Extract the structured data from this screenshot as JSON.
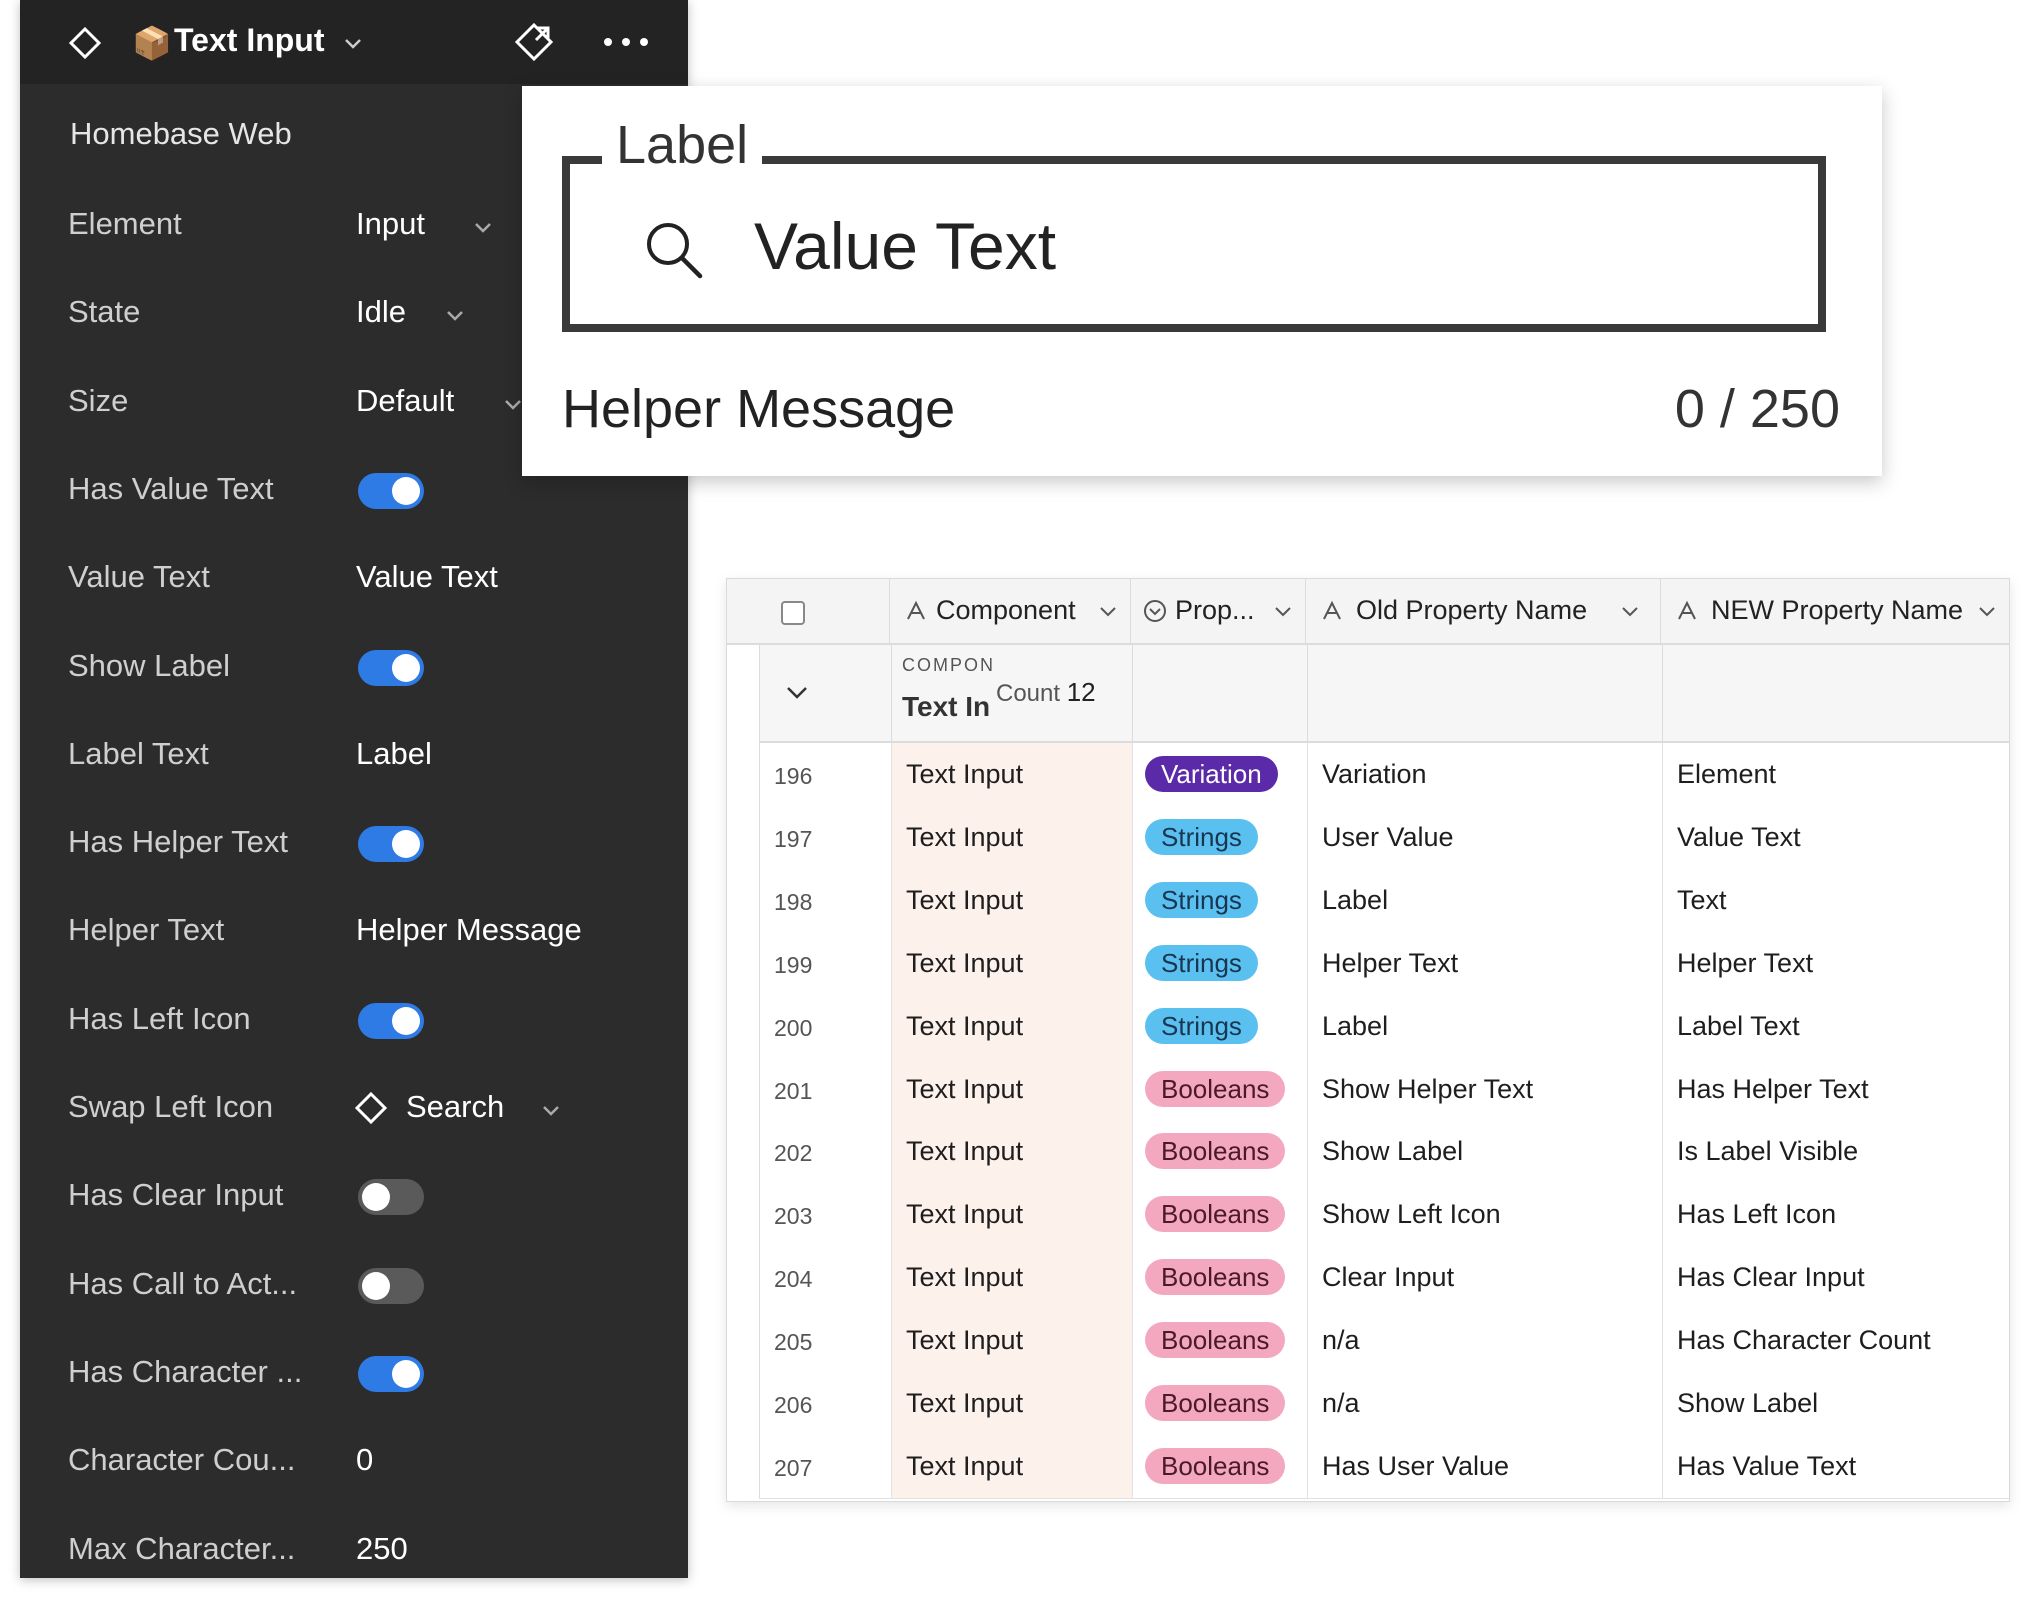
{
  "panel": {
    "title": "Text Input",
    "library": "Homebase Web",
    "properties": [
      {
        "label": "Element",
        "type": "dropdown",
        "value": "Input"
      },
      {
        "label": "State",
        "type": "dropdown",
        "value": "Idle"
      },
      {
        "label": "Size",
        "type": "dropdown",
        "value": "Default"
      },
      {
        "label": "Has Value Text",
        "type": "toggle",
        "on": true
      },
      {
        "label": "Value Text",
        "type": "text",
        "value": "Value Text"
      },
      {
        "label": "Show Label",
        "type": "toggle",
        "on": true
      },
      {
        "label": "Label Text",
        "type": "text",
        "value": "Label"
      },
      {
        "label": "Has Helper Text",
        "type": "toggle",
        "on": true
      },
      {
        "label": "Helper Text",
        "type": "text",
        "value": "Helper Message"
      },
      {
        "label": "Has Left Icon",
        "type": "toggle",
        "on": true
      },
      {
        "label": "Swap Left Icon",
        "type": "instance",
        "value": "Search"
      },
      {
        "label": "Has Clear Input",
        "type": "toggle",
        "on": false
      },
      {
        "label": "Has Call to Act...",
        "type": "toggle",
        "on": false
      },
      {
        "label": "Has Character ...",
        "type": "toggle",
        "on": true
      },
      {
        "label": "Character Cou...",
        "type": "text",
        "value": "0"
      },
      {
        "label": "Max Character...",
        "type": "text",
        "value": "250"
      }
    ],
    "toggle_on_color": "#2f7be6"
  },
  "preview": {
    "label": "Label",
    "value": "Value Text",
    "helper": "Helper Message",
    "counter": "0 / 250",
    "icon": "search-icon"
  },
  "table": {
    "columns": [
      {
        "label": "Component",
        "icon": "text-field-icon"
      },
      {
        "label": "Prop...",
        "icon": "single-select-icon"
      },
      {
        "label": "Old Property Name",
        "icon": "text-field-icon"
      },
      {
        "label": "NEW Property Name",
        "icon": "text-field-icon"
      }
    ],
    "group": {
      "field": "COMPON",
      "value": "Text In",
      "count_label": "Count",
      "count": "12"
    },
    "rows": [
      {
        "num": "196",
        "component": "Text Input",
        "prop": "Variation",
        "prop_kind": "variation",
        "old": "Variation",
        "new": "Element"
      },
      {
        "num": "197",
        "component": "Text Input",
        "prop": "Strings",
        "prop_kind": "strings",
        "old": "User Value",
        "new": "Value Text"
      },
      {
        "num": "198",
        "component": "Text Input",
        "prop": "Strings",
        "prop_kind": "strings",
        "old": "Label",
        "new": "Text"
      },
      {
        "num": "199",
        "component": "Text Input",
        "prop": "Strings",
        "prop_kind": "strings",
        "old": "Helper Text",
        "new": "Helper Text"
      },
      {
        "num": "200",
        "component": "Text Input",
        "prop": "Strings",
        "prop_kind": "strings",
        "old": "Label",
        "new": "Label Text"
      },
      {
        "num": "201",
        "component": "Text Input",
        "prop": "Booleans",
        "prop_kind": "booleans",
        "old": "Show Helper Text",
        "new": "Has Helper Text"
      },
      {
        "num": "202",
        "component": "Text Input",
        "prop": "Booleans",
        "prop_kind": "booleans",
        "old": "Show Label",
        "new": "Is Label Visible"
      },
      {
        "num": "203",
        "component": "Text Input",
        "prop": "Booleans",
        "prop_kind": "booleans",
        "old": "Show Left Icon",
        "new": "Has Left Icon"
      },
      {
        "num": "204",
        "component": "Text Input",
        "prop": "Booleans",
        "prop_kind": "booleans",
        "old": "Clear Input",
        "new": "Has Clear Input"
      },
      {
        "num": "205",
        "component": "Text Input",
        "prop": "Booleans",
        "prop_kind": "booleans",
        "old": "n/a",
        "new": "Has Character Count"
      },
      {
        "num": "206",
        "component": "Text Input",
        "prop": "Booleans",
        "prop_kind": "booleans",
        "old": "n/a",
        "new": "Show Label"
      },
      {
        "num": "207",
        "component": "Text Input",
        "prop": "Booleans",
        "prop_kind": "booleans",
        "old": "Has User Value",
        "new": "Has Value Text"
      }
    ],
    "pill_colors": {
      "variation": "#5b2aa8",
      "strings": "#5ac0f0",
      "booleans": "#f4a8c0"
    }
  }
}
